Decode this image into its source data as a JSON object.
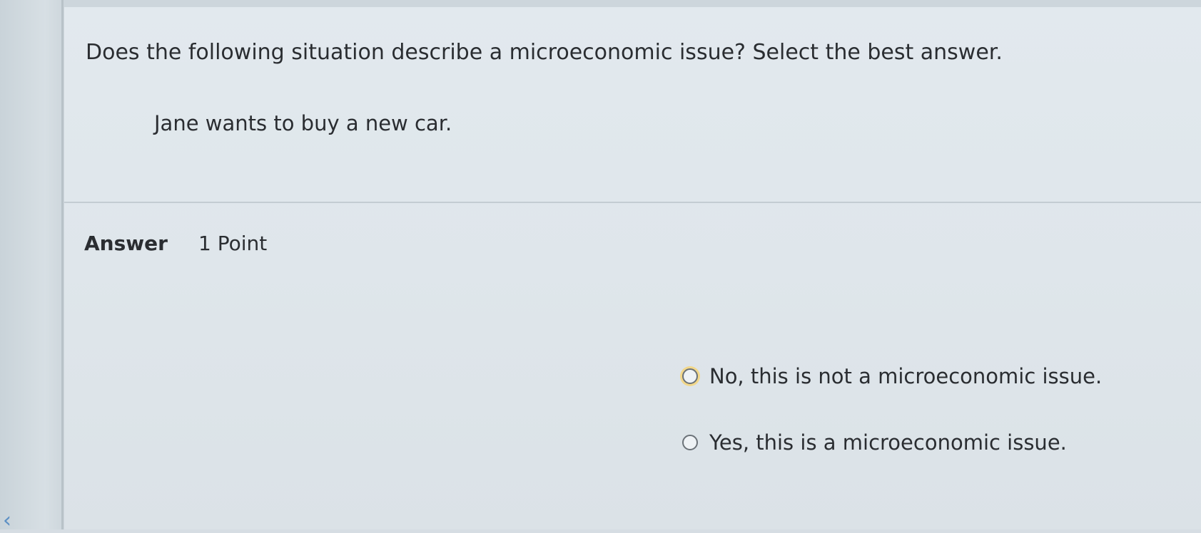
{
  "question": {
    "prompt": "Does the following situation describe a microeconomic issue? Select the best answer.",
    "scenario": "Jane wants to buy a new car."
  },
  "answer": {
    "label": "Answer",
    "points": "1 Point",
    "options": [
      {
        "label": "No, this is not a microeconomic issue.",
        "selected": false
      },
      {
        "label": "Yes, this is a microeconomic issue.",
        "selected": false
      }
    ]
  },
  "nav": {
    "back_icon": "chevron-left-icon",
    "back_glyph": "‹"
  },
  "colors": {
    "accent": "#5b8fc4",
    "focus_ring": "#f2d78a"
  }
}
